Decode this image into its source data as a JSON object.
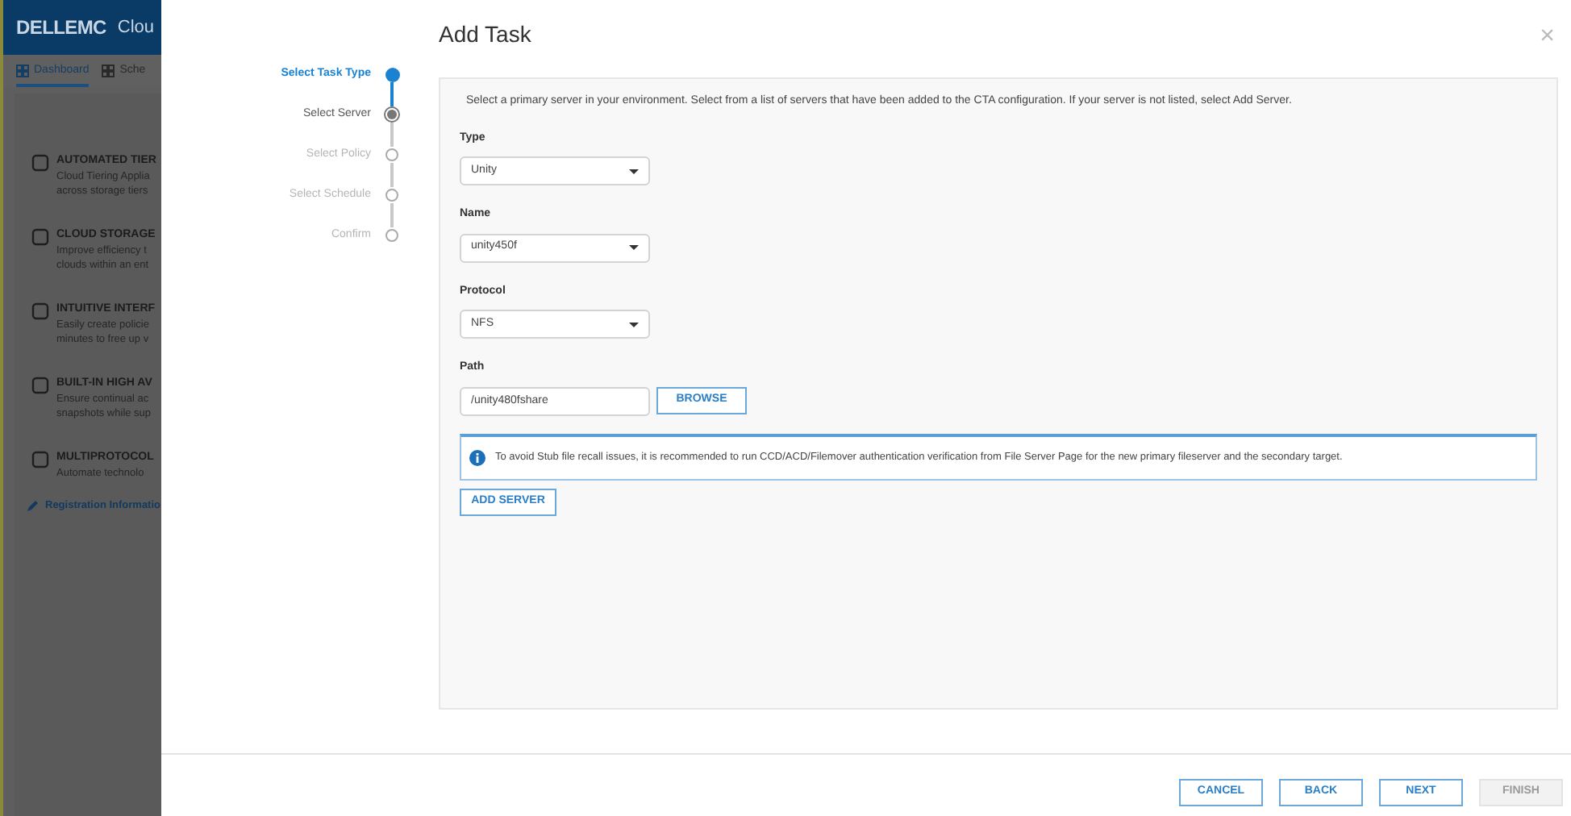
{
  "background_app": {
    "logo": "DELLEMC",
    "title": "Clou",
    "tabs": [
      {
        "label": "Dashboard",
        "selected": true
      },
      {
        "label": "Sche",
        "selected": false
      }
    ],
    "features": [
      {
        "heading": "AUTOMATED TIER",
        "lines": [
          "Cloud Tiering Applia",
          "across storage tiers"
        ]
      },
      {
        "heading": "CLOUD STORAGE",
        "lines": [
          "Improve efficiency t",
          "clouds within an ent"
        ]
      },
      {
        "heading": "INTUITIVE INTERF",
        "lines": [
          "Easily create policie",
          "minutes to free up v"
        ]
      },
      {
        "heading": "BUILT-IN HIGH AV",
        "lines": [
          "Ensure continual ac",
          "snapshots while sup"
        ]
      },
      {
        "heading": "MULTIPROTOCOL",
        "lines": [
          "Automate technolo"
        ]
      }
    ],
    "link": "Registration Informatio"
  },
  "dialog": {
    "title": "Add Task",
    "close": "×",
    "steps": [
      {
        "label": "Select Task Type",
        "completed": true,
        "selected": false
      },
      {
        "label": "Select Server",
        "completed": false,
        "selected": true
      },
      {
        "label": "Select Policy",
        "completed": false,
        "selected": false
      },
      {
        "label": "Select Schedule",
        "completed": false,
        "selected": false
      },
      {
        "label": "Confirm",
        "completed": false,
        "selected": false
      }
    ],
    "intro": "Select a primary server in your environment. Select from a list of servers that have been added to the CTA configuration. If your server is not listed, select Add Server.",
    "fields": [
      {
        "label": "Type",
        "kind": "dropdown",
        "value": "Unity"
      },
      {
        "label": "Name",
        "kind": "dropdown",
        "value": "unity450f"
      },
      {
        "label": "Protocol",
        "kind": "dropdown",
        "value": "NFS"
      },
      {
        "label": "Path",
        "kind": "text",
        "value": "/unity480fshare",
        "button": "BROWSE"
      }
    ],
    "info": "To avoid Stub file recall issues, it is recommended to run CCD/ACD/Filemover authentication verification from File Server Page for the new primary fileserver and the secondary target.",
    "add_server": "ADD SERVER",
    "buttons": [
      {
        "label": "CANCEL",
        "disabled": false
      },
      {
        "label": "BACK",
        "disabled": false
      },
      {
        "label": "NEXT",
        "disabled": false
      },
      {
        "label": "FINISH",
        "disabled": true
      }
    ]
  }
}
